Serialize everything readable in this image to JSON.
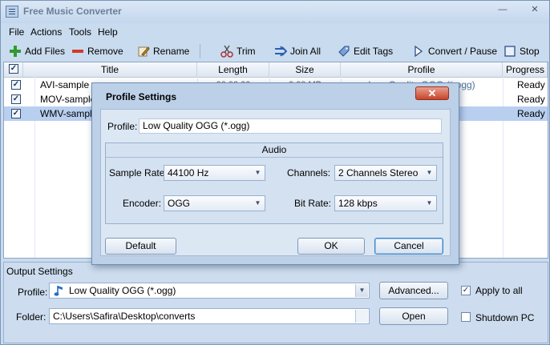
{
  "app": {
    "title": "Free Music Converter",
    "minimize": "—",
    "close": "✕"
  },
  "menu": [
    "File",
    "Actions",
    "Tools",
    "Help"
  ],
  "toolbar": {
    "add_files": "Add Files",
    "remove": "Remove",
    "rename": "Rename",
    "trim": "Trim",
    "join_all": "Join All",
    "edit_tags": "Edit Tags",
    "convert_pause": "Convert / Pause",
    "stop": "Stop"
  },
  "table": {
    "columns": [
      "Title",
      "Length",
      "Size",
      "Profile",
      "Progress"
    ],
    "rows": [
      {
        "checked": true,
        "title": "AVI-sample",
        "length": "00:00:00",
        "size": "0.00 MB",
        "profile": "Low Quality OGG (*.ogg)",
        "progress": "Ready"
      },
      {
        "checked": true,
        "title": "MOV-sample",
        "length": "",
        "size": "",
        "profile": "",
        "progress": "Ready"
      },
      {
        "checked": true,
        "title": "WMV-sample",
        "length": "",
        "size": "",
        "profile": "",
        "progress": "Ready"
      }
    ],
    "check_mark": "✓"
  },
  "dialog": {
    "title": "Profile Settings",
    "close": "✕",
    "profile_label": "Profile:",
    "profile_value": "Low Quality OGG (*.ogg)",
    "group_title": "Audio",
    "sample_rate_label": "Sample Rate:",
    "sample_rate_value": "44100 Hz",
    "channels_label": "Channels:",
    "channels_value": "2 Channels Stereo",
    "encoder_label": "Encoder:",
    "encoder_value": "OGG",
    "bitrate_label": "Bit Rate:",
    "bitrate_value": "128 kbps",
    "default_btn": "Default",
    "ok_btn": "OK",
    "cancel_btn": "Cancel"
  },
  "output": {
    "section_title": "Output Settings",
    "profile_label": "Profile:",
    "profile_value": "Low Quality OGG (*.ogg)",
    "advanced_btn": "Advanced...",
    "apply_to_all": "Apply to all",
    "apply_checked": true,
    "folder_label": "Folder:",
    "folder_value": "C:\\Users\\Safira\\Desktop\\converts",
    "open_btn": "Open",
    "shutdown_pc": "Shutdown PC",
    "shutdown_checked": false
  },
  "icons": {
    "app": "list-icon",
    "add": "plus-icon",
    "remove": "minus-icon",
    "rename": "pencil-icon",
    "trim": "scissors-icon",
    "join": "arrows-icon",
    "tags": "tag-icon",
    "convert": "play-icon",
    "stop": "stop-icon",
    "music": "music-note-icon"
  },
  "colors": {
    "selected_row": "#b8cff0",
    "dialog_close": "#c9442a",
    "add_icon": "#2f9a2f",
    "remove_icon": "#d23a2a"
  }
}
